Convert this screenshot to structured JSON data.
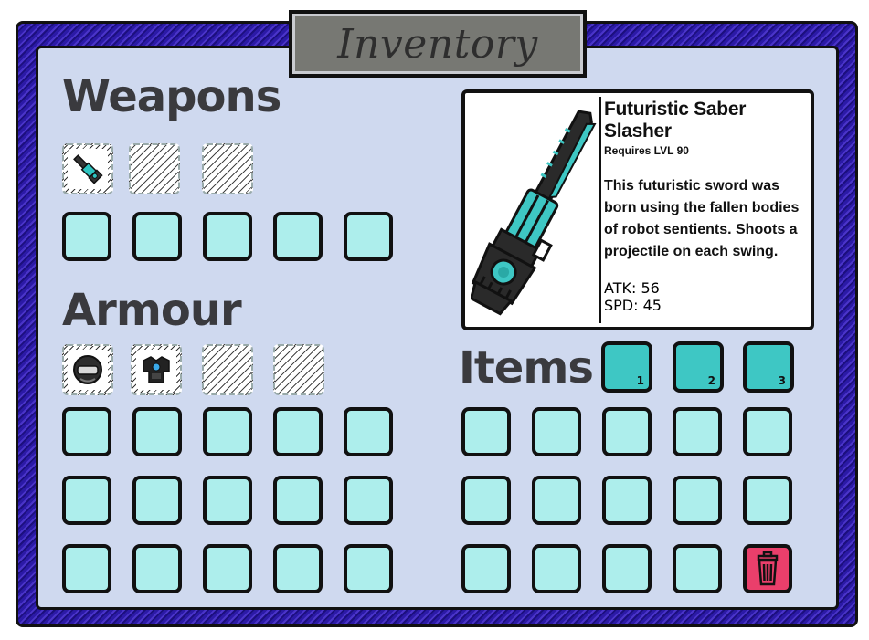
{
  "title": "Inventory",
  "sections": {
    "weapons": "Weapons",
    "armour": "Armour",
    "items": "Items"
  },
  "selected_item": {
    "name": "Futuristic Saber Slasher",
    "requirement": "Requires LVL 90",
    "description": "This futuristic sword was born using the fallen bodies of robot sentients.  Shoots a projectile on each swing.",
    "atk": "ATK: 56",
    "spd": "SPD: 45"
  },
  "quick_slots": [
    "1",
    "2",
    "3"
  ],
  "equipped": {
    "weapons": [
      "saber-icon",
      "",
      ""
    ],
    "armour": [
      "helmet-icon",
      "chest-armor-icon",
      "",
      ""
    ]
  },
  "icons": {
    "trash": "trash-icon"
  },
  "colors": {
    "slot": "#adeeec",
    "quick_slot": "#3ec7c4",
    "trash": "#ea3f6b",
    "panel": "#cfd9ef",
    "frame": "#2b1aa6"
  }
}
